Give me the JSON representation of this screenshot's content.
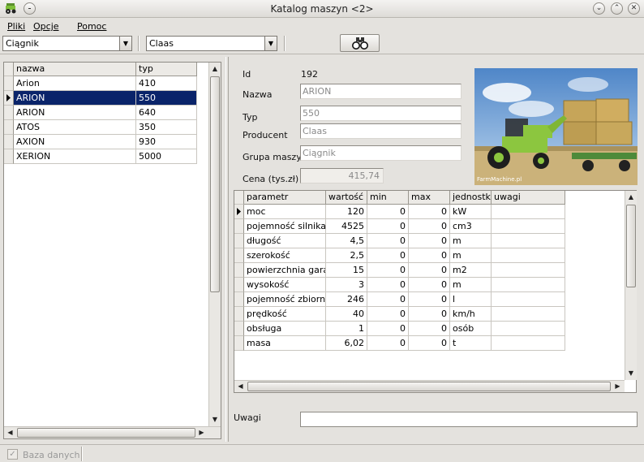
{
  "window": {
    "title": "Katalog maszyn <2>"
  },
  "menu": {
    "items": [
      "Pliki",
      "Opcje",
      "Pomoc"
    ]
  },
  "toolbar": {
    "category_value": "Ciągnik",
    "producer_value": "Claas"
  },
  "list": {
    "columns": [
      "nazwa",
      "typ"
    ],
    "rows": [
      {
        "nazwa": "Arion",
        "typ": "410"
      },
      {
        "nazwa": "ARION",
        "typ": "550"
      },
      {
        "nazwa": "ARION",
        "typ": "640"
      },
      {
        "nazwa": "ATOS",
        "typ": "350"
      },
      {
        "nazwa": "AXION",
        "typ": "930"
      },
      {
        "nazwa": "XERION",
        "typ": "5000"
      }
    ],
    "selected_index": 1
  },
  "detail": {
    "id_label": "Id",
    "id_value": "192",
    "nazwa_label": "Nazwa",
    "nazwa_value": "ARION",
    "typ_label": "Typ",
    "typ_value": "550",
    "producent_label": "Producent",
    "producent_value": "Claas",
    "grupa_label": "Grupa maszyn",
    "grupa_value": "Ciągnik",
    "cena_label": "Cena (tys.zł)",
    "cena_value": "415,74",
    "photo_caption": "FarmMachine.pl"
  },
  "params": {
    "columns": [
      "parametr",
      "wartość",
      "min",
      "max",
      "jednostka",
      "uwagi"
    ],
    "rows": [
      {
        "parametr": "moc",
        "wartosc": "120",
        "min": "0",
        "max": "0",
        "jednostka": "kW",
        "uwagi": ""
      },
      {
        "parametr": "pojemność silnika",
        "wartosc": "4525",
        "min": "0",
        "max": "0",
        "jednostka": "cm3",
        "uwagi": ""
      },
      {
        "parametr": "długość",
        "wartosc": "4,5",
        "min": "0",
        "max": "0",
        "jednostka": "m",
        "uwagi": ""
      },
      {
        "parametr": "szerokość",
        "wartosc": "2,5",
        "min": "0",
        "max": "0",
        "jednostka": "m",
        "uwagi": ""
      },
      {
        "parametr": "powierzchnia garażu",
        "wartosc": "15",
        "min": "0",
        "max": "0",
        "jednostka": "m2",
        "uwagi": ""
      },
      {
        "parametr": "wysokość",
        "wartosc": "3",
        "min": "0",
        "max": "0",
        "jednostka": "m",
        "uwagi": ""
      },
      {
        "parametr": "pojemność zbiornika",
        "wartosc": "246",
        "min": "0",
        "max": "0",
        "jednostka": "l",
        "uwagi": ""
      },
      {
        "parametr": "prędkość",
        "wartosc": "40",
        "min": "0",
        "max": "0",
        "jednostka": "km/h",
        "uwagi": ""
      },
      {
        "parametr": "obsługa",
        "wartosc": "1",
        "min": "0",
        "max": "0",
        "jednostka": "osób",
        "uwagi": ""
      },
      {
        "parametr": "masa",
        "wartosc": "6,02",
        "min": "0",
        "max": "0",
        "jednostka": "t",
        "uwagi": ""
      }
    ]
  },
  "notes": {
    "label": "Uwagi",
    "value": ""
  },
  "status": {
    "db_label": "Baza danych",
    "db_checked": true
  },
  "icons": [
    "app-tractor-icon",
    "window-menu-icon",
    "minimize-icon",
    "maximize-icon",
    "close-icon",
    "binoculars-icon",
    "dropdown-arrow-icon",
    "row-pointer-icon",
    "scroll-up-icon",
    "scroll-down-icon",
    "scroll-left-icon",
    "scroll-right-icon",
    "checkbox-icon"
  ],
  "colors": {
    "selection": "#0a246a",
    "window_bg": "#e4e2de"
  }
}
